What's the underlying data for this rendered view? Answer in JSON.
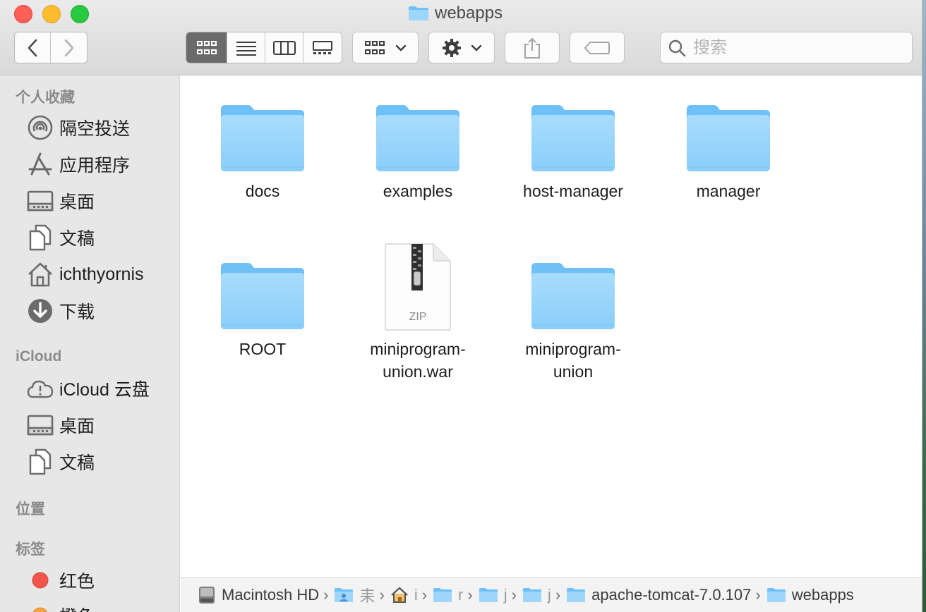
{
  "window": {
    "title": "webapps"
  },
  "toolbar": {
    "view_modes": [
      "icon-view",
      "list-view",
      "column-view",
      "gallery-view"
    ],
    "search_placeholder": "搜索"
  },
  "sidebar": {
    "favorites_heading": "个人收藏",
    "favorites": [
      {
        "label": "隔空投送",
        "icon": "airdrop-icon"
      },
      {
        "label": "应用程序",
        "icon": "applications-icon"
      },
      {
        "label": "桌面",
        "icon": "desktop-icon"
      },
      {
        "label": "文稿",
        "icon": "documents-icon"
      },
      {
        "label": "ichthyornis",
        "icon": "home-icon"
      },
      {
        "label": "下载",
        "icon": "downloads-icon"
      }
    ],
    "icloud_heading": "iCloud",
    "icloud": [
      {
        "label": "iCloud 云盘",
        "icon": "icloud-drive-icon"
      },
      {
        "label": "桌面",
        "icon": "desktop-icon"
      },
      {
        "label": "文稿",
        "icon": "documents-icon"
      }
    ],
    "locations_heading": "位置",
    "tags_heading": "标签",
    "tags": [
      {
        "label": "红色",
        "color": "#f0544c"
      },
      {
        "label": "橙色",
        "color": "#f5a33c"
      }
    ]
  },
  "files": [
    {
      "name": "docs",
      "type": "folder"
    },
    {
      "name": "examples",
      "type": "folder"
    },
    {
      "name": "host-manager",
      "type": "folder"
    },
    {
      "name": "manager",
      "type": "folder"
    },
    {
      "name": "ROOT",
      "type": "folder"
    },
    {
      "name_line1": "miniprogram-",
      "name_line2": "union.war",
      "type": "zip",
      "badge": "ZIP"
    },
    {
      "name_line1": "miniprogram-",
      "name_line2": "union",
      "type": "folder"
    }
  ],
  "pathbar": {
    "segments": [
      {
        "label": "Macintosh HD",
        "icon": "disk-icon"
      },
      {
        "label": "⽾",
        "icon": "user-folder-icon"
      },
      {
        "label": "i",
        "icon": "home-icon"
      },
      {
        "label": "r",
        "icon": "folder-icon"
      },
      {
        "label": "j",
        "icon": "folder-icon"
      },
      {
        "label": "j",
        "icon": "folder-icon"
      },
      {
        "label": "apache-tomcat-7.0.107",
        "icon": "folder-icon"
      },
      {
        "label": "webapps",
        "icon": "folder-icon"
      }
    ]
  },
  "colors": {
    "folder_light": "#9ed6fb",
    "folder_dark": "#5fb5f3",
    "active_segment": "#6a6a6a"
  }
}
